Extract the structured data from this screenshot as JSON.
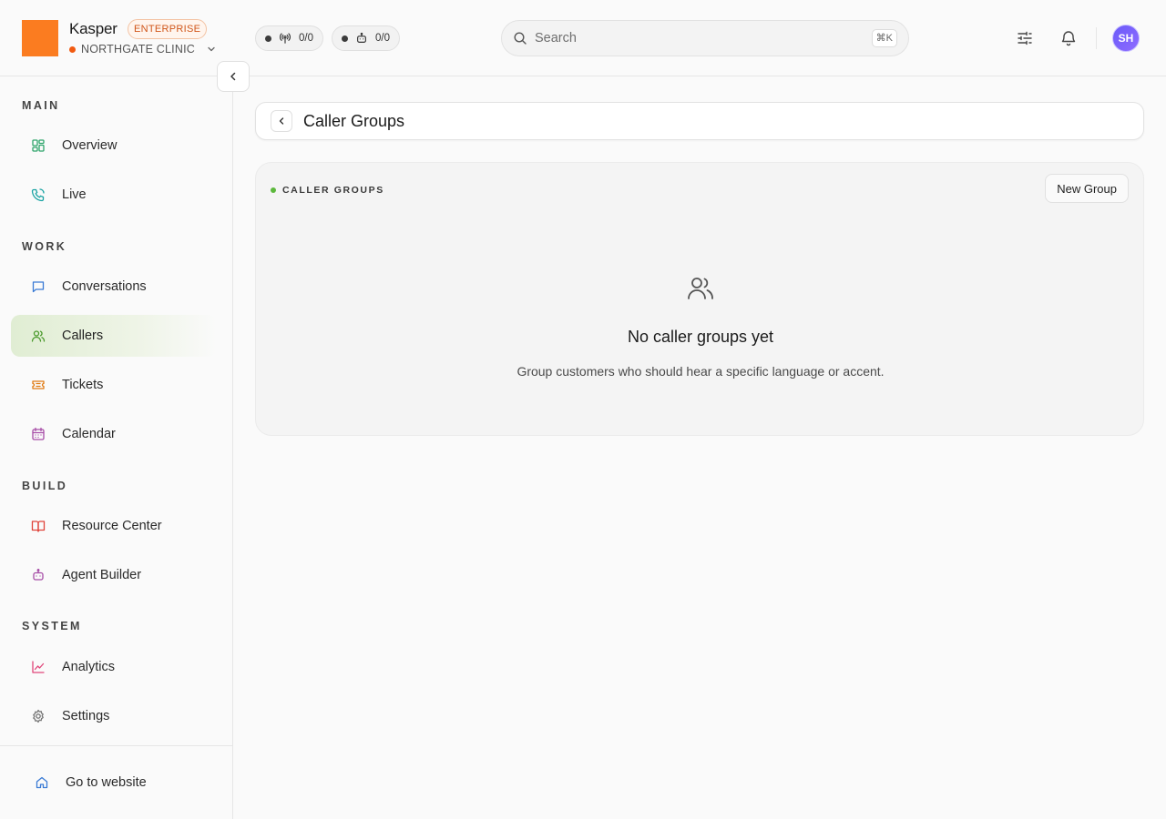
{
  "app": {
    "name": "Kasper",
    "plan_badge": "ENTERPRISE",
    "org_name": "NORTHGATE CLINIC",
    "logo_color": "#fb7c20"
  },
  "status_pills": [
    {
      "icon": "antenna-icon",
      "value": "0/0"
    },
    {
      "icon": "robot-icon",
      "value": "0/0"
    }
  ],
  "search": {
    "placeholder": "Search",
    "shortcut": "⌘K"
  },
  "user": {
    "initials": "SH"
  },
  "sidebar": {
    "sections": [
      {
        "label": "MAIN",
        "items": [
          {
            "label": "Overview",
            "icon": "grid-icon",
            "color": "#2ea56b"
          },
          {
            "label": "Live",
            "icon": "phone-icon",
            "color": "#1aa3a3"
          }
        ]
      },
      {
        "label": "WORK",
        "items": [
          {
            "label": "Conversations",
            "icon": "chat-icon",
            "color": "#3a7bd5"
          },
          {
            "label": "Callers",
            "icon": "users-icon",
            "color": "#4a9a2c",
            "active": true
          },
          {
            "label": "Tickets",
            "icon": "ticket-icon",
            "color": "#e07b14"
          },
          {
            "label": "Calendar",
            "icon": "calendar-icon",
            "color": "#a64ca6"
          }
        ]
      },
      {
        "label": "BUILD",
        "items": [
          {
            "label": "Resource Center",
            "icon": "book-icon",
            "color": "#e0433a"
          },
          {
            "label": "Agent Builder",
            "icon": "robot-icon",
            "color": "#a64ca6"
          }
        ]
      },
      {
        "label": "SYSTEM",
        "items": [
          {
            "label": "Analytics",
            "icon": "chart-line-icon",
            "color": "#e0467a"
          },
          {
            "label": "Settings",
            "icon": "gear-icon",
            "color": "#777777"
          }
        ]
      }
    ],
    "footer_item": {
      "label": "Go to website",
      "icon": "home-icon",
      "color": "#3a7bd5"
    }
  },
  "page": {
    "title": "Caller Groups",
    "card_label": "CALLER GROUPS",
    "new_button": "New Group",
    "empty_title": "No caller groups yet",
    "empty_description": "Group customers who should hear a specific language or accent."
  }
}
